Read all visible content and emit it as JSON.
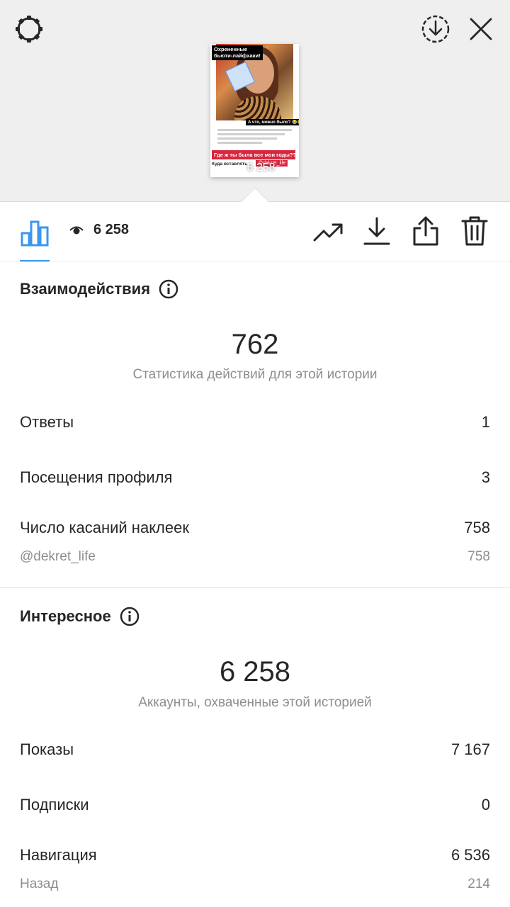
{
  "story_preview": {
    "caption_title": "Охрененные бьюти-лайфхаки!",
    "caption_question": "А что, можно было? 😂😂",
    "caption_red": "Где ж ты была все мои годы???",
    "caption_where": "Куда вставлять -",
    "caption_mention": "@dekret_life",
    "views_overlay": "6 258"
  },
  "toolbar": {
    "views_count": "6 258"
  },
  "interactions": {
    "title": "Взаимодействия",
    "total": "762",
    "subtitle": "Статистика действий для этой истории",
    "rows": [
      {
        "label": "Ответы",
        "value": "1"
      },
      {
        "label": "Посещения профиля",
        "value": "3"
      },
      {
        "label": "Число касаний наклеек",
        "value": "758"
      }
    ],
    "sticker_sub": {
      "label": "@dekret_life",
      "value": "758"
    }
  },
  "discovery": {
    "title": "Интересное",
    "total": "6 258",
    "subtitle": "Аккаунты, охваченные этой историей",
    "rows": [
      {
        "label": "Показы",
        "value": "7 167"
      },
      {
        "label": "Подписки",
        "value": "0"
      },
      {
        "label": "Навигация",
        "value": "6 536"
      }
    ],
    "nav_sub": {
      "label": "Назад",
      "value": "214"
    }
  },
  "colors": {
    "accent": "#3897f0",
    "secondary_text": "#8e8e8e",
    "header_bg": "#efefef"
  }
}
